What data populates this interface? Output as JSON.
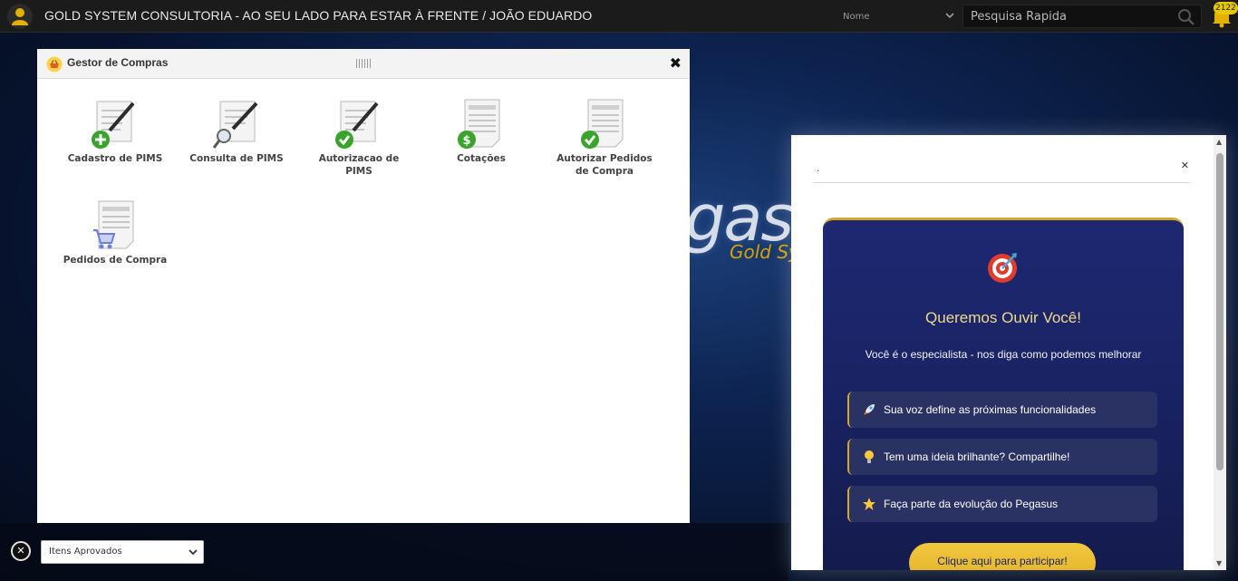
{
  "topbar": {
    "title": "GOLD SYSTEM CONSULTORIA - AO SEU LADO PARA ESTAR À FRENTE / JOÃO EDUARDO",
    "search_by": "Nome",
    "search_placeholder": "Pesquisa Rapida",
    "notification_count": "2122"
  },
  "brand": {
    "main": "gasus",
    "sub": "Gold Sy"
  },
  "gestor": {
    "title": "Gestor de Compras",
    "items": [
      {
        "label": "Cadastro de PIMS",
        "icon": "document-add-icon"
      },
      {
        "label": "Consulta de PIMS",
        "icon": "document-search-icon"
      },
      {
        "label": "Autorizacao de PIMS",
        "icon": "document-check-icon"
      },
      {
        "label": "Cotações",
        "icon": "price-document-icon"
      },
      {
        "label": "Autorizar Pedidos de Compra",
        "icon": "order-check-icon"
      },
      {
        "label": "Pedidos de Compra",
        "icon": "shopping-cart-document-icon"
      }
    ]
  },
  "bottombar": {
    "select_value": "Itens Aprovados"
  },
  "popup": {
    "header_text": ".",
    "title": "Queremos Ouvir Você!",
    "subtitle": "Você é o especialista - nos diga como podemos melhorar",
    "features": [
      {
        "text": "Sua voz define as próximas funcionalidades",
        "icon": "rocket-icon"
      },
      {
        "text": "Tem uma ideia brilhante? Compartilhe!",
        "icon": "lightbulb-icon"
      },
      {
        "text": "Faça parte da evolução do Pegasus",
        "icon": "star-icon"
      }
    ],
    "cta": "Clique aqui para participar!"
  },
  "colors": {
    "accent_gold": "#d4a72a",
    "card_blue": "#1e2872",
    "success_green": "#3aa32c"
  }
}
